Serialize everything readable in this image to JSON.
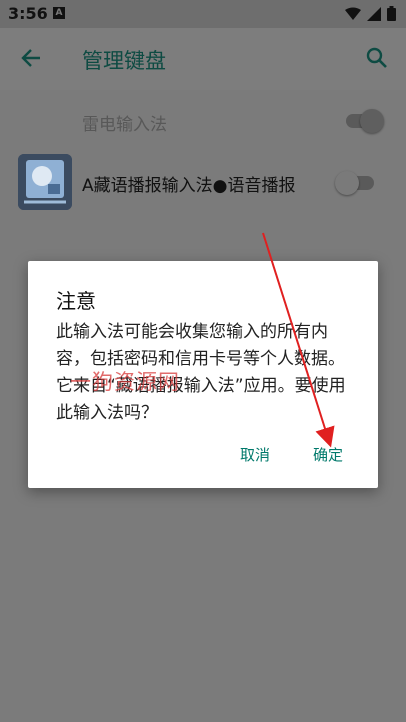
{
  "status_bar": {
    "time": "3:56",
    "notification_icon": "A"
  },
  "app_bar": {
    "title": "管理键盘",
    "back_icon": "arrow-back-icon",
    "search_icon": "search-icon"
  },
  "keyboards": [
    {
      "label": "雷电输入法",
      "enabled": true
    },
    {
      "label": "A藏语播报输入法●语音播报",
      "enabled": false
    }
  ],
  "dialog": {
    "title": "注意",
    "message": "此输入法可能会收集您输入的所有内容，包括密码和信用卡号等个人数据。它来自“藏语播报输入法”应用。要使用此输入法吗？",
    "cancel_label": "取消",
    "ok_label": "确定"
  },
  "watermark": "一狗资源网",
  "colors": {
    "accent": "#00796b",
    "scrim": "#7b7b7b",
    "annotation": "#e02020"
  }
}
